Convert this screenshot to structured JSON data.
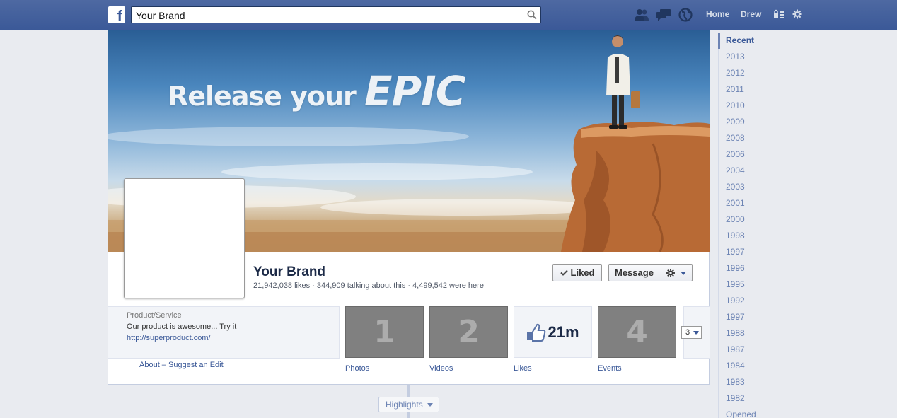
{
  "topbar": {
    "logo_letter": "f",
    "search": {
      "value": "Your Brand",
      "placeholder": ""
    },
    "nav": {
      "home": "Home",
      "user": "Drew"
    }
  },
  "cover": {
    "headline_prefix": "Release your",
    "headline_emphasis": "EPIC"
  },
  "page": {
    "name": "Your Brand",
    "stats": "21,942,038 likes · 344,909 talking about this · 4,499,542 were here"
  },
  "actions": {
    "liked": "Liked",
    "message": "Message"
  },
  "about": {
    "category": "Product/Service",
    "description": "Our product is awesome... Try it",
    "website": "http://superproduct.com/",
    "links": "About – Suggest an Edit"
  },
  "apps": [
    {
      "tile_text": "1",
      "label": "Photos"
    },
    {
      "tile_text": "2",
      "label": "Videos"
    },
    {
      "tile_text": "21m",
      "label": "Likes"
    },
    {
      "tile_text": "4",
      "label": "Events"
    }
  ],
  "more_apps_count": "3",
  "highlights": "Highlights",
  "scrubber": {
    "years": [
      "Recent",
      "2013",
      "2012",
      "2011",
      "2010",
      "2009",
      "2008",
      "2006",
      "2004",
      "2003",
      "2001",
      "2000",
      "1998",
      "1997",
      "1996",
      "1995",
      "1992",
      "1997",
      "1988",
      "1987",
      "1984",
      "1983",
      "1982",
      "Opened"
    ],
    "active": "Recent"
  },
  "colors": {
    "topbar": "#3b5998",
    "link": "#3b5998",
    "tile_gray": "#808080",
    "page_bg": "#e9ebf0"
  }
}
